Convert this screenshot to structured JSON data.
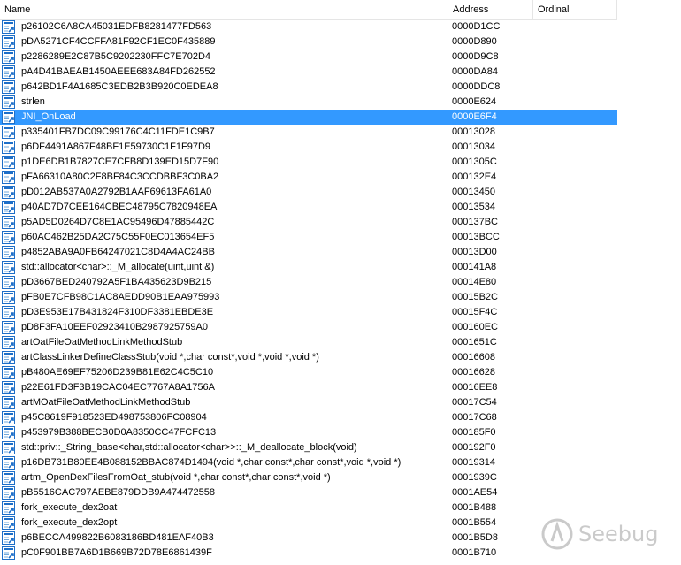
{
  "columns": {
    "name": "Name",
    "address": "Address",
    "ordinal": "Ordinal"
  },
  "rows": [
    {
      "name": "p26102C6A8CA45031EDFB8281477FD563",
      "address": "0000D1CC",
      "ordinal": ""
    },
    {
      "name": "pDA5271CF4CCFFA81F92CF1EC0F435889",
      "address": "0000D890",
      "ordinal": ""
    },
    {
      "name": "p2286289E2C87B5C9202230FFC7E702D4",
      "address": "0000D9C8",
      "ordinal": ""
    },
    {
      "name": "pA4D41BAEAB1450AEEE683A84FD262552",
      "address": "0000DA84",
      "ordinal": ""
    },
    {
      "name": "p642BD1F4A1685C3EDB2B3B920C0EDEA8",
      "address": "0000DDC8",
      "ordinal": ""
    },
    {
      "name": "strlen",
      "address": "0000E624",
      "ordinal": ""
    },
    {
      "name": "JNI_OnLoad",
      "address": "0000E6F4",
      "ordinal": "",
      "selected": true
    },
    {
      "name": "p335401FB7DC09C99176C4C11FDE1C9B7",
      "address": "00013028",
      "ordinal": ""
    },
    {
      "name": "p6DF4491A867F48BF1E59730C1F1F97D9",
      "address": "00013034",
      "ordinal": ""
    },
    {
      "name": "p1DE6DB1B7827CE7CFB8D139ED15D7F90",
      "address": "0001305C",
      "ordinal": ""
    },
    {
      "name": "pFA66310A80C2F8BF84C3CCDBBF3C0BA2",
      "address": "000132E4",
      "ordinal": ""
    },
    {
      "name": "pD012AB537A0A2792B1AAF69613FA61A0",
      "address": "00013450",
      "ordinal": ""
    },
    {
      "name": "p40AD7D7CEE164CBEC48795C7820948EA",
      "address": "00013534",
      "ordinal": ""
    },
    {
      "name": "p5AD5D0264D7C8E1AC95496D47885442C",
      "address": "000137BC",
      "ordinal": ""
    },
    {
      "name": "p60AC462B25DA2C75C55F0EC013654EF5",
      "address": "00013BCC",
      "ordinal": ""
    },
    {
      "name": "p4852ABA9A0FB64247021C8D4A4AC24BB",
      "address": "00013D00",
      "ordinal": ""
    },
    {
      "name": "std::allocator<char>::_M_allocate(uint,uint &)",
      "address": "000141A8",
      "ordinal": ""
    },
    {
      "name": "pD3667BED240792A5F1BA435623D9B215",
      "address": "00014E80",
      "ordinal": ""
    },
    {
      "name": "pFB0E7CFB98C1AC8AEDD90B1EAA975993",
      "address": "00015B2C",
      "ordinal": ""
    },
    {
      "name": "pD3E953E17B431824F310DF3381EBDE3E",
      "address": "00015F4C",
      "ordinal": ""
    },
    {
      "name": "pD8F3FA10EEF02923410B2987925759A0",
      "address": "000160EC",
      "ordinal": ""
    },
    {
      "name": "artOatFileOatMethodLinkMethodStub",
      "address": "0001651C",
      "ordinal": ""
    },
    {
      "name": "artClassLinkerDefineClassStub(void *,char const*,void *,void *,void *)",
      "address": "00016608",
      "ordinal": ""
    },
    {
      "name": "pB480AE69EF75206D239B81E62C4C5C10",
      "address": "00016628",
      "ordinal": ""
    },
    {
      "name": "p22E61FD3F3B19CAC04EC7767A8A1756A",
      "address": "00016EE8",
      "ordinal": ""
    },
    {
      "name": "artMOatFileOatMethodLinkMethodStub",
      "address": "00017C54",
      "ordinal": ""
    },
    {
      "name": "p45C8619F918523ED498753806FC08904",
      "address": "00017C68",
      "ordinal": ""
    },
    {
      "name": "p453979B388BECB0D0A8350CC47FCFC13",
      "address": "000185F0",
      "ordinal": ""
    },
    {
      "name": "std::priv::_String_base<char,std::allocator<char>>::_M_deallocate_block(void)",
      "address": "000192F0",
      "ordinal": ""
    },
    {
      "name": "p16DB731B80EE4B088152BBAC874D1494(void *,char const*,char const*,void *,void *)",
      "address": "00019314",
      "ordinal": ""
    },
    {
      "name": "artm_OpenDexFilesFromOat_stub(void *,char const*,char const*,void *)",
      "address": "0001939C",
      "ordinal": ""
    },
    {
      "name": "pB5516CAC797AEBE879DDB9A474472558",
      "address": "0001AE54",
      "ordinal": ""
    },
    {
      "name": "fork_execute_dex2oat",
      "address": "0001B488",
      "ordinal": ""
    },
    {
      "name": "fork_execute_dex2opt",
      "address": "0001B554",
      "ordinal": ""
    },
    {
      "name": "p6BECCA499822B6083186BD481EAF40B3",
      "address": "0001B5D8",
      "ordinal": ""
    },
    {
      "name": "pC0F901BB7A6D1B669B72D78E6861439F",
      "address": "0001B710",
      "ordinal": ""
    }
  ],
  "watermark": {
    "text": "Seebug"
  },
  "colors": {
    "selection": "#3399ff",
    "icon_blue": "#1e6fc8"
  }
}
